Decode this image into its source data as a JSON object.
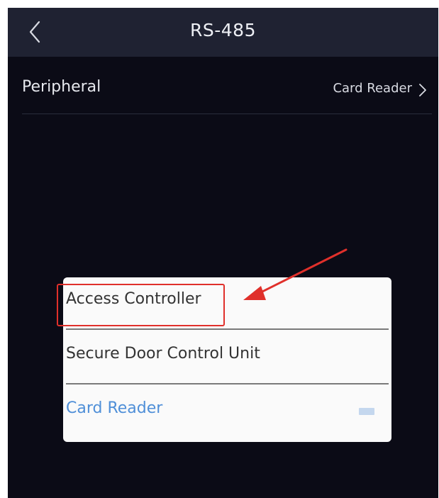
{
  "header": {
    "title": "RS-485",
    "back_icon": "chevron-left-icon"
  },
  "setting": {
    "label": "Peripheral",
    "value": "Card Reader",
    "chevron_icon": "chevron-right-icon"
  },
  "popup": {
    "options": [
      {
        "label": "Access Controller",
        "selected": false
      },
      {
        "label": "Secure Door Control Unit",
        "selected": false
      },
      {
        "label": "Card Reader",
        "selected": true
      }
    ]
  },
  "annotation": {
    "highlight_color": "#e0302b",
    "arrow_color": "#e0302b"
  },
  "colors": {
    "screen_bg": "#0b0b16",
    "header_bg": "#1f2232",
    "selected_text": "#4f8fd8"
  }
}
